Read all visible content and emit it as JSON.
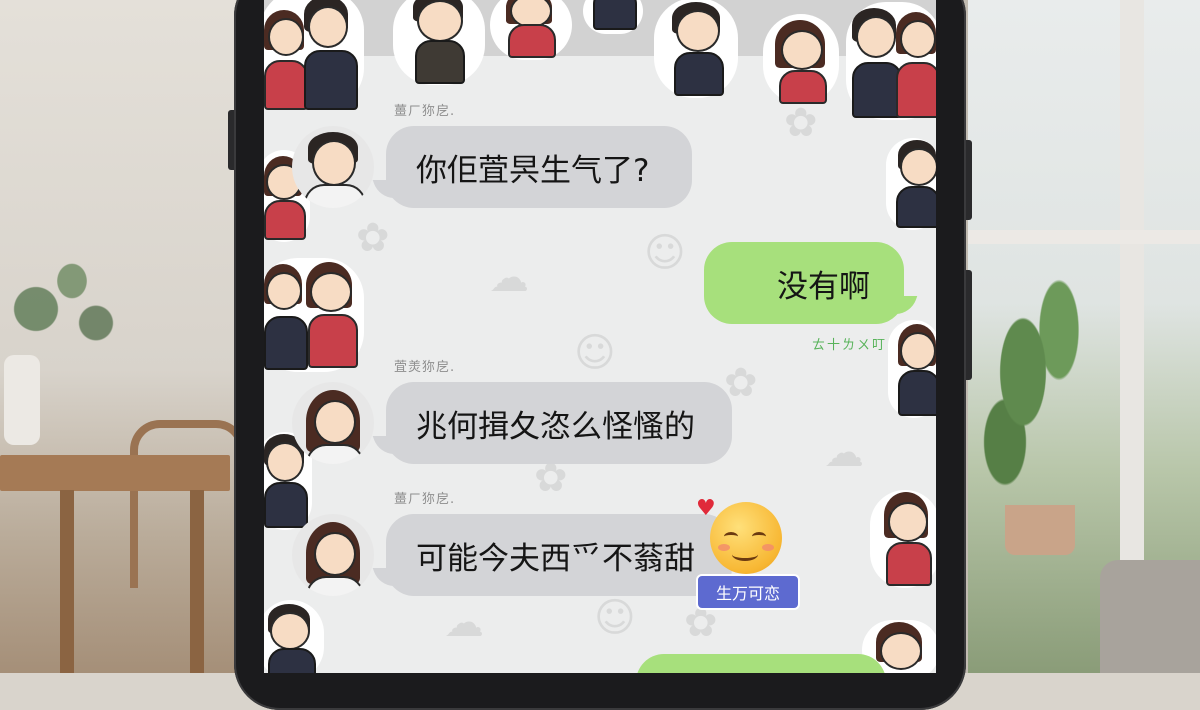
{
  "chat": {
    "messages": [
      {
        "sender_label": "薑ㄏ狝戹.",
        "text": "你佢萓昗生气了?",
        "direction": "incoming"
      },
      {
        "text": "没有啊",
        "direction": "outgoing",
        "status": "ㄊ十ㄌㄨ叮"
      },
      {
        "sender_label": "萓羙狝戹.",
        "text": "兆何揖夂恣么怪慅的",
        "direction": "incoming"
      },
      {
        "sender_label": "薑ㄏ狝戹.",
        "text": "可能今夫西爫不蓊甜",
        "direction": "incoming"
      }
    ],
    "sticker": {
      "icon": "smiling-face-with-heart-icon",
      "label": "生万可恋"
    }
  },
  "colors": {
    "incoming_bubble": "#d3d4d7",
    "outgoing_bubble": "#a7e07c",
    "sticker_label_bg": "#5d6ad0"
  }
}
